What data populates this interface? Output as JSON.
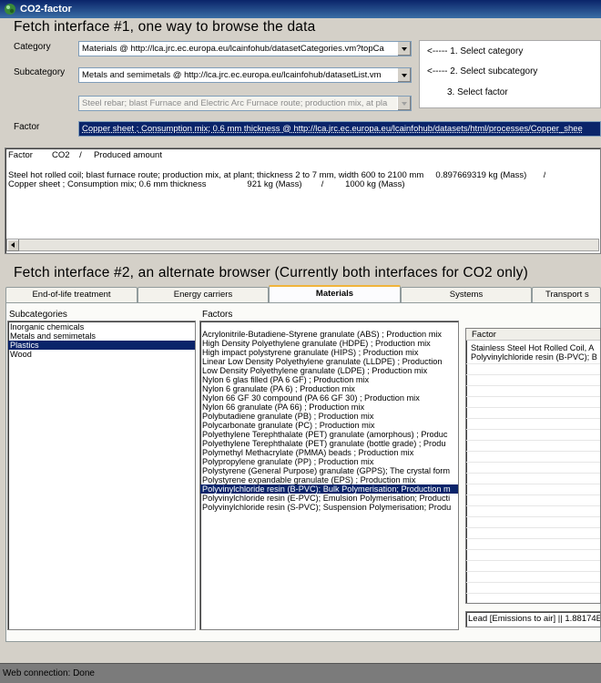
{
  "window": {
    "title": "CO2-factor"
  },
  "section1": {
    "heading": "Fetch interface #1, one way to browse the data",
    "category": {
      "label": "Category",
      "value": "Materials @ http://lca.jrc.ec.europa.eu/lcainfohub/datasetCategories.vm?topCa"
    },
    "subcategory": {
      "label": "Subcategory",
      "value": "Metals and semimetals @ http://lca.jrc.ec.europa.eu/lcainfohub/datasetList.vm"
    },
    "dataset": {
      "value": "Steel rebar; blast Furnace and Electric Arc Furnace route; production mix, at pla"
    },
    "steps": [
      "<----- 1. Select category",
      "<----- 2. Select subcategory",
      "3. Select factor"
    ],
    "factor": {
      "label": "Factor",
      "value": "Copper sheet ; Consumption mix; 0.6 mm thickness  @ http://lca.jrc.ec.europa.eu/lcainfohub/datasets/html/processes/Copper_shee"
    }
  },
  "output": {
    "header": "Factor        CO2    /     Produced amount",
    "lines": [
      "Steel hot rolled coil; blast furnace route; production mix, at plant; thickness 2 to 7 mm, width 600 to 2100 mm     0.897669319 kg (Mass)       /",
      "Copper sheet ; Consumption mix; 0.6 mm thickness                 921 kg (Mass)        /         1000 kg (Mass)"
    ]
  },
  "section2": {
    "heading": "Fetch interface #2, an alternate browser (Currently both interfaces for CO2 only)",
    "tabs": [
      "End-of-life treatment",
      "Energy carriers",
      "Materials",
      "Systems",
      "Transport s"
    ],
    "active_tab": "Materials",
    "subcategories_label": "Subcategories",
    "subcategories": [
      "Inorganic chemicals",
      "Metals and semimetals",
      "Plastics",
      "Wood"
    ],
    "selected_subcategory": "Plastics",
    "factors_label": "Factors",
    "factors": [
      "Acrylonitrile-Butadiene-Styrene granulate (ABS) ; Production mix",
      "High Density Polyethylene granulate (HDPE) ; Production mix",
      "High impact polystyrene granulate (HIPS) ; Production mix",
      "Linear Low Density Polyethylene granulate (LLDPE) ; Production",
      "Low Density Polyethylene granulate (LDPE) ; Production mix",
      "Nylon 6 glas filled (PA 6 GF) ; Production mix",
      "Nylon 6 granulate (PA 6) ; Production mix",
      "Nylon 66 GF 30 compound (PA 66 GF 30) ; Production mix",
      "Nylon 66 granulate (PA 66) ; Production mix",
      "Polybutadiene granulate (PB) ; Production mix",
      "Polycarbonate granulate (PC) ; Production mix",
      "Polyethylene Terephthalate (PET) granulate (amorphous) ; Produc",
      "Polyethylene Terephthalate (PET) granulate (bottle grade) ; Produ",
      "Polymethyl Methacrylate (PMMA) beads ; Production mix",
      "Polypropylene granulate (PP) ; Production mix",
      "Polystyrene (General Purpose) granulate (GPPS); The crystal form",
      "Polystyrene expandable granulate (EPS) ; Production mix",
      "Polyvinylchloride resin (B-PVC); Bulk Polymerisation; Production m",
      "Polyvinylchloride resin (E-PVC); Emulsion Polymerisation; Producti",
      "Polyvinylchloride resin (S-PVC); Suspension Polymerisation; Produ"
    ],
    "selected_factor": "Polyvinylchloride resin (B-PVC); Bulk Polymerisation; Production m",
    "result_header": "Factor",
    "results": [
      "Stainless Steel Hot Rolled Coil, A",
      "Polyvinylchloride resin (B-PVC); B"
    ],
    "bottom_field": "Lead [Emissions to air] || 1.88174E"
  },
  "status": {
    "text": "Web connection: Done"
  },
  "colors": {
    "titlebar": "#0a246a",
    "selection": "#0a246a",
    "tab_highlight": "#f0b43b"
  }
}
